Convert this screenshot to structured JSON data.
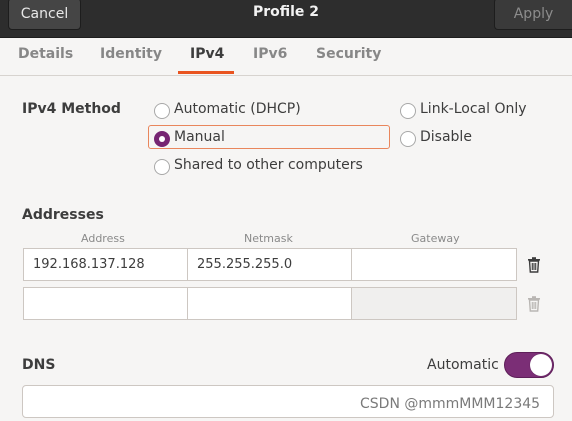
{
  "header": {
    "cancel_label": "Cancel",
    "title": "Profile 2",
    "apply_label": "Apply"
  },
  "tabs": [
    {
      "label": "Details",
      "active": false
    },
    {
      "label": "Identity",
      "active": false
    },
    {
      "label": "IPv4",
      "active": true
    },
    {
      "label": "IPv6",
      "active": false
    },
    {
      "label": "Security",
      "active": false
    }
  ],
  "ipv4_method": {
    "label": "IPv4 Method",
    "options": [
      {
        "label": "Automatic (DHCP)",
        "selected": false
      },
      {
        "label": "Link-Local Only",
        "selected": false
      },
      {
        "label": "Manual",
        "selected": true
      },
      {
        "label": "Disable",
        "selected": false
      },
      {
        "label": "Shared to other computers",
        "selected": false
      }
    ]
  },
  "addresses": {
    "label": "Addresses",
    "columns": [
      "Address",
      "Netmask",
      "Gateway"
    ],
    "rows": [
      {
        "address": "192.168.137.128",
        "netmask": "255.255.255.0",
        "gateway": ""
      },
      {
        "address": "",
        "netmask": "",
        "gateway": ""
      }
    ]
  },
  "dns": {
    "label": "DNS",
    "automatic_label": "Automatic",
    "automatic_on": true,
    "value": ""
  },
  "watermark": "CSDN @mmmMMM12345",
  "colors": {
    "accent": "#e95420",
    "switch_on": "#7b2e76",
    "header_bg": "#2d2d2d"
  },
  "icons": [
    "trash-icon"
  ]
}
